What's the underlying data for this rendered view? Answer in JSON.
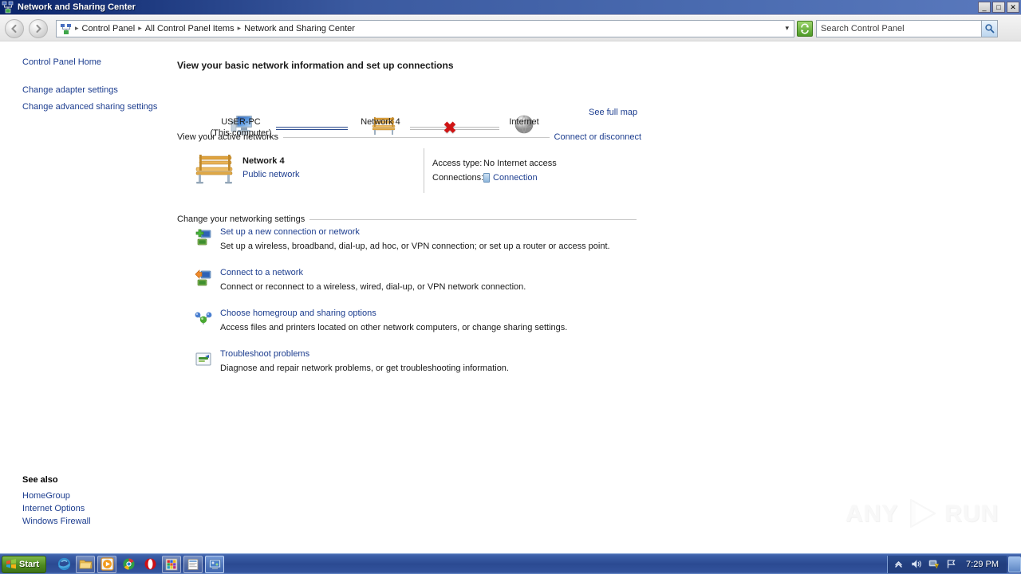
{
  "window": {
    "title": "Network and Sharing Center",
    "icon": "network-sharing-icon",
    "minimize_label": "_",
    "maximize_label": "□",
    "close_label": "✕"
  },
  "addressbar": {
    "back_icon": "back-arrow-icon",
    "forward_icon": "forward-arrow-icon",
    "crumb_icon": "control-panel-icon",
    "crumbs": [
      "Control Panel",
      "All Control Panel Items",
      "Network and Sharing Center"
    ],
    "separator": "▸",
    "dropdown_icon": "chevron-down-icon",
    "refresh_icon": "refresh-icon",
    "search_placeholder": "Search Control Panel",
    "search_value": "",
    "search_icon": "magnifier-icon"
  },
  "help": {
    "label": "?",
    "icon": "help-icon"
  },
  "sidebar": {
    "items": [
      {
        "label": "Control Panel Home"
      },
      {
        "label": "Change adapter settings"
      },
      {
        "label": "Change advanced sharing settings"
      }
    ],
    "see_also_title": "See also",
    "see_also": [
      {
        "label": "HomeGroup"
      },
      {
        "label": "Internet Options"
      },
      {
        "label": "Windows Firewall"
      }
    ]
  },
  "main": {
    "heading": "View your basic network information and set up connections",
    "map": {
      "see_full_map": "See full map",
      "nodes": [
        {
          "name": "computer-node",
          "icon": "computer-icon",
          "label_line1": "USER-PC",
          "label_line2": "(This computer)"
        },
        {
          "name": "network-node",
          "icon": "bench-icon",
          "label_line1": "Network  4",
          "label_line2": ""
        },
        {
          "name": "internet-node",
          "icon": "globe-icon",
          "label_line1": "Internet",
          "label_line2": ""
        }
      ],
      "link_connected_color": "#2b4b8f",
      "link_broken_color": "#b9b9b9",
      "broken_marker": "✖",
      "broken_marker_color": "#d01414"
    },
    "active_networks": {
      "section_title": "View your active networks",
      "action_link": "Connect or disconnect",
      "network_name": "Network  4",
      "network_type": "Public network",
      "network_icon": "bench-icon",
      "details": [
        {
          "label": "Access type:",
          "value": "No Internet access",
          "is_link": false,
          "icon": ""
        },
        {
          "label": "Connections:",
          "value": "Connection",
          "is_link": true,
          "icon": "connection-icon"
        }
      ]
    },
    "change_settings": {
      "section_title": "Change your networking settings",
      "items": [
        {
          "icon": "new-connection-icon",
          "title": "Set up a new connection or network",
          "description": "Set up a wireless, broadband, dial-up, ad hoc, or VPN connection; or set up a router or access point."
        },
        {
          "icon": "connect-network-icon",
          "title": "Connect to a network",
          "description": "Connect or reconnect to a wireless, wired, dial-up, or VPN network connection."
        },
        {
          "icon": "homegroup-icon",
          "title": "Choose homegroup and sharing options",
          "description": "Access files and printers located on other network computers, or change sharing settings."
        },
        {
          "icon": "troubleshoot-icon",
          "title": "Troubleshoot problems",
          "description": "Diagnose and repair network problems, or get troubleshooting information."
        }
      ]
    }
  },
  "watermark": {
    "text_left": "ANY",
    "text_right": "RUN",
    "icon": "play-logo-icon"
  },
  "taskbar": {
    "start_label": "Start",
    "start_icon": "windows-flag-icon",
    "quick_launch": [
      {
        "icon": "internet-explorer-icon",
        "framed": false
      },
      {
        "icon": "windows-explorer-icon",
        "framed": true
      },
      {
        "icon": "media-player-icon",
        "framed": true
      },
      {
        "icon": "chrome-icon",
        "framed": false
      },
      {
        "icon": "opera-icon",
        "framed": false
      },
      {
        "icon": "colorful-app-icon",
        "framed": true
      },
      {
        "icon": "document-app-icon",
        "framed": true
      },
      {
        "icon": "network-sharing-icon",
        "framed": true,
        "active": true
      }
    ],
    "tray": [
      {
        "icon": "show-hidden-icons-icon"
      },
      {
        "icon": "volume-icon"
      },
      {
        "icon": "network-warning-icon"
      },
      {
        "icon": "action-center-flag-icon"
      }
    ],
    "clock": "7:29 PM",
    "show_desktop_icon": "show-desktop-icon"
  },
  "colors": {
    "link": "#1c3d8f",
    "titlebar_start": "#0a246a",
    "titlebar_end": "#5a79bd",
    "taskbar": "#2b4a92",
    "error_red": "#d01414"
  }
}
